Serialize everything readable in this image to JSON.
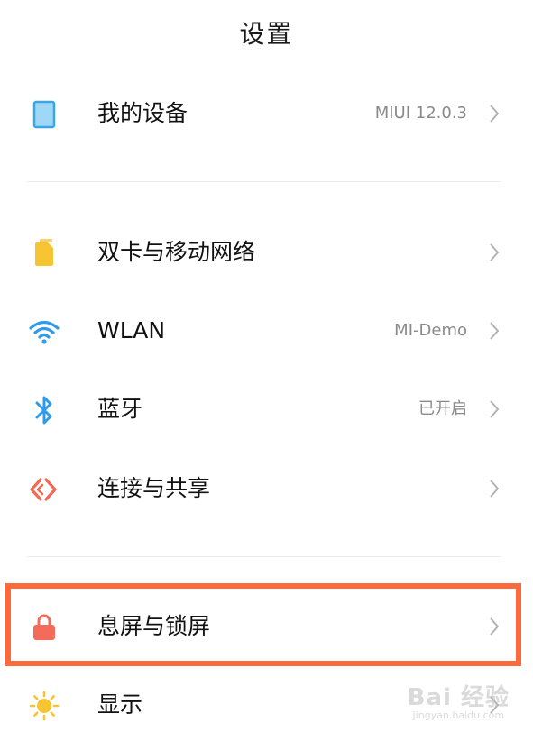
{
  "header": {
    "title": "设置"
  },
  "items": [
    {
      "id": "my-device",
      "label": "我的设备",
      "value": "MIUI 12.0.3",
      "icon": "tablet-icon"
    },
    {
      "id": "sim-network",
      "label": "双卡与移动网络",
      "value": "",
      "icon": "sim-card-icon"
    },
    {
      "id": "wlan",
      "label": "WLAN",
      "value": "MI-Demo",
      "icon": "wifi-icon"
    },
    {
      "id": "bluetooth",
      "label": "蓝牙",
      "value": "已开启",
      "icon": "bluetooth-icon"
    },
    {
      "id": "connection-sharing",
      "label": "连接与共享",
      "value": "",
      "icon": "connection-share-icon"
    },
    {
      "id": "lockscreen",
      "label": "息屏与锁屏",
      "value": "",
      "icon": "lock-icon"
    },
    {
      "id": "display",
      "label": "显示",
      "value": "",
      "icon": "sun-icon"
    }
  ],
  "colors": {
    "highlight": "#ff6a3c",
    "sim": "#f7c531",
    "wifi": "#2f9bea",
    "lock": "#f26b5b",
    "sun": "#f7c531",
    "device": "#58b8f0"
  },
  "watermark": {
    "main": "Bai 经验",
    "sub": "jingyan.baidu.com"
  }
}
